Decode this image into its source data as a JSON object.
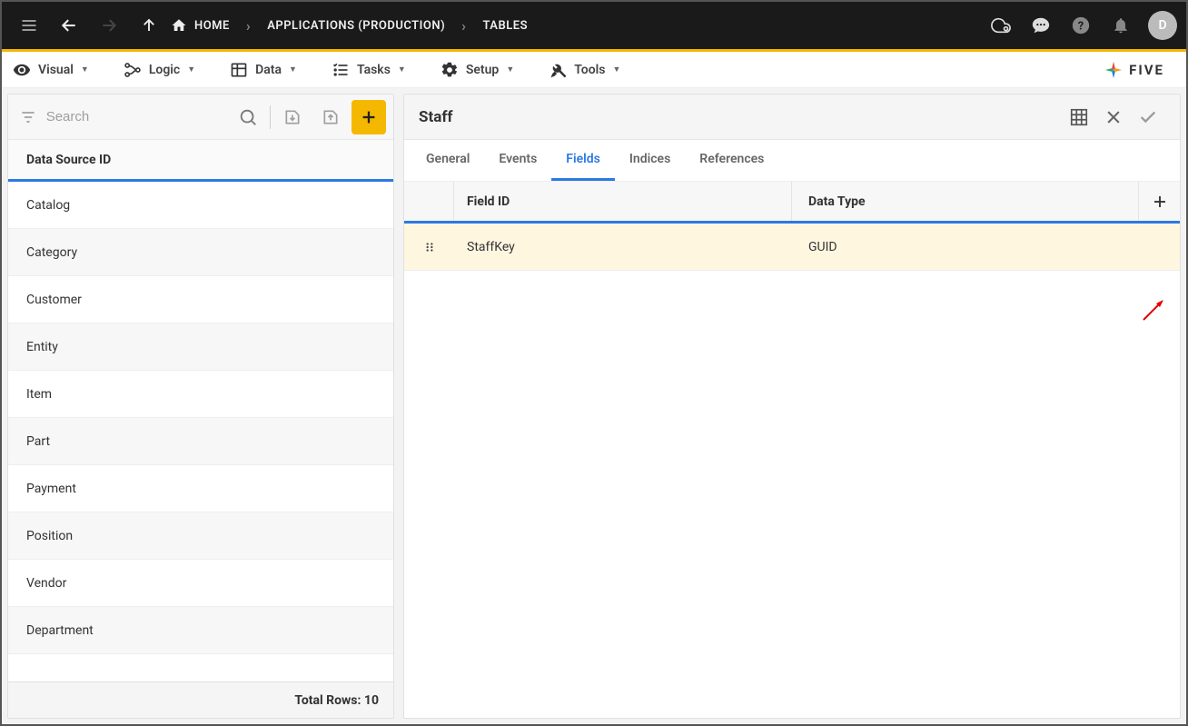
{
  "topbar": {
    "breadcrumbs": [
      "HOME",
      "APPLICATIONS (PRODUCTION)",
      "TABLES"
    ],
    "avatar_initial": "D"
  },
  "menubar": {
    "items": [
      "Visual",
      "Logic",
      "Data",
      "Tasks",
      "Setup",
      "Tools"
    ],
    "brand": "FIVE"
  },
  "left_panel": {
    "search_placeholder": "Search",
    "header": "Data Source ID",
    "rows": [
      "Catalog",
      "Category",
      "Customer",
      "Entity",
      "Item",
      "Part",
      "Payment",
      "Position",
      "Vendor",
      "Department"
    ],
    "footer_label": "Total Rows: 10"
  },
  "right_panel": {
    "title": "Staff",
    "tabs": [
      "General",
      "Events",
      "Fields",
      "Indices",
      "References"
    ],
    "active_tab_index": 2,
    "field_columns": {
      "c1": "Field ID",
      "c2": "Data Type"
    },
    "field_rows": [
      {
        "field_id": "StaffKey",
        "data_type": "GUID"
      }
    ]
  }
}
